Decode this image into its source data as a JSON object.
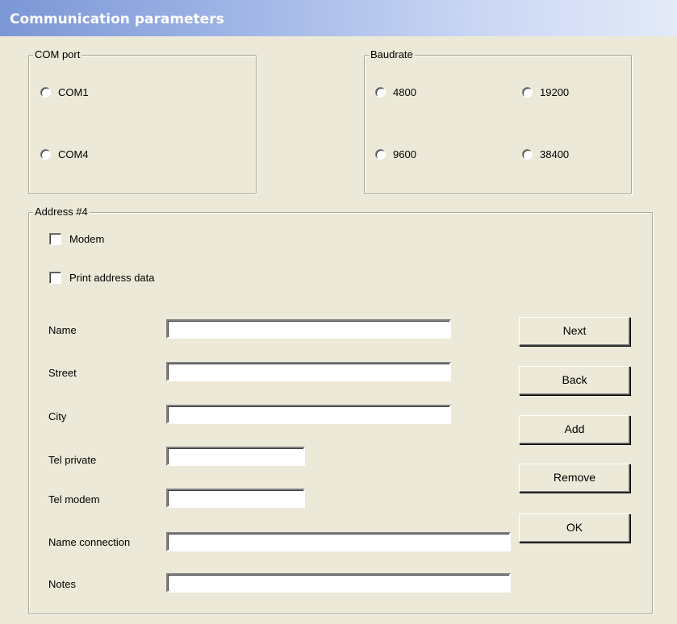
{
  "window": {
    "title": "Communication parameters"
  },
  "com_port": {
    "legend": "COM port",
    "options": [
      "COM1",
      "COM4"
    ]
  },
  "baudrate": {
    "legend": "Baudrate",
    "options": [
      "4800",
      "19200",
      "9600",
      "38400"
    ]
  },
  "address": {
    "legend": "Address #4",
    "checkboxes": {
      "modem": "Modem",
      "print": "Print address data"
    },
    "fields": {
      "name": {
        "label": "Name",
        "value": ""
      },
      "street": {
        "label": "Street",
        "value": ""
      },
      "city": {
        "label": "City",
        "value": ""
      },
      "tel_private": {
        "label": "Tel private",
        "value": ""
      },
      "tel_modem": {
        "label": "Tel modem",
        "value": ""
      },
      "name_connection": {
        "label": "Name connection",
        "value": ""
      },
      "notes": {
        "label": "Notes",
        "value": ""
      }
    },
    "buttons": {
      "next": "Next",
      "back": "Back",
      "add": "Add",
      "remove": "Remove",
      "ok": "OK"
    }
  }
}
